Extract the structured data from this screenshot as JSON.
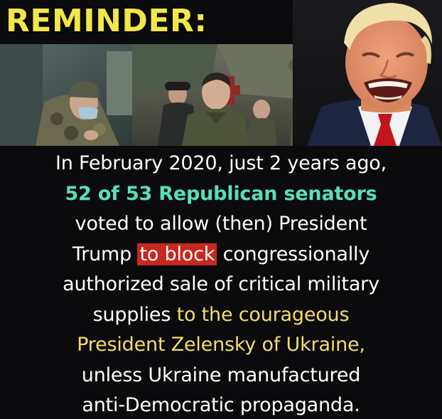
{
  "headline": "REMINDER:",
  "images": {
    "soldier_photo": "soldier-in-camouflage-with-mask-photo",
    "zelensky_photo": "zelensky-with-officials-photo",
    "trump_photo": "trump-shouting-photo"
  },
  "message": {
    "line1": "In February 2020, just 2 years ago,",
    "line2_highlight": "52 of 53 Republican senators",
    "line3": "voted to allow (then) President",
    "line4_prefix": "Trump ",
    "line4_red": "to block",
    "line4_suffix": " congressionally",
    "line5": "authorized sale of critical military",
    "line6_prefix": "supplies ",
    "line6_yellow": "to the courageous",
    "line7_yellow": "President Zelensky of Ukraine,",
    "line8": "unless Ukraine manufactured",
    "line9": "anti-Democratic propaganda."
  },
  "colors": {
    "background": "#0b0b0d",
    "headline": "#f2e64b",
    "teal": "#58e0b8",
    "yellow": "#f4dd6a",
    "red_highlight": "#c7281f",
    "text": "#ffffff"
  }
}
